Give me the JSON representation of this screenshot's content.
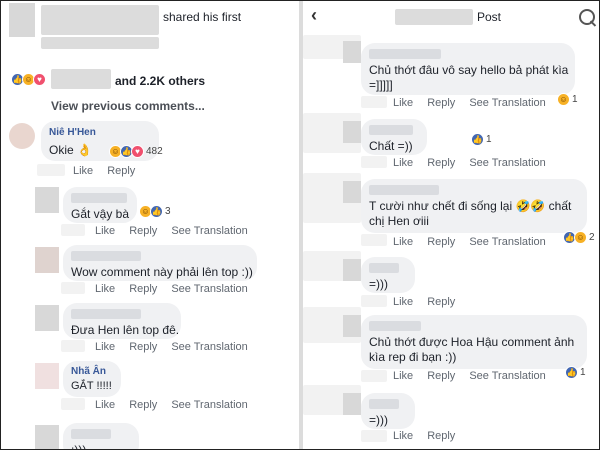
{
  "left": {
    "header_text": "shared his first",
    "reactions_summary": "and 2.2K others",
    "view_previous": "View previous comments...",
    "actions": {
      "like": "Like",
      "reply": "Reply",
      "see_translation": "See Translation"
    },
    "comments": [
      {
        "author": "Niê H'Hen",
        "text": "Okie 👌",
        "reaction_count": "482"
      },
      {
        "text": "Gắt vậy bà",
        "reaction_count": "3"
      },
      {
        "text": "Wow comment này phải lên top :))"
      },
      {
        "text": "Đưa Hen lên top đê."
      },
      {
        "author": "Nhã Ân",
        "text": "GẮT !!!!!"
      },
      {
        "text": ":)))"
      }
    ]
  },
  "right": {
    "header_text": "Post",
    "actions": {
      "like": "Like",
      "reply": "Reply",
      "see_translation": "See Translation"
    },
    "comments": [
      {
        "line1": "Chủ thớt đâu vô say hello bả phát kìa",
        "line2": "=]]]]]",
        "reaction_count": "1"
      },
      {
        "line1": "Chất =))",
        "reaction_count": "1"
      },
      {
        "line1": "T cười như chết đi sống lại 🤣🤣 chất",
        "line2": "chị Hen ơiii",
        "reaction_count": "2"
      },
      {
        "line1": "=)))"
      },
      {
        "line1": "Chủ thớt được Hoa Hậu comment ảnh",
        "line2": "kìa rep đi bạn :))",
        "reaction_count": "1"
      },
      {
        "line1": "=)))"
      }
    ]
  }
}
